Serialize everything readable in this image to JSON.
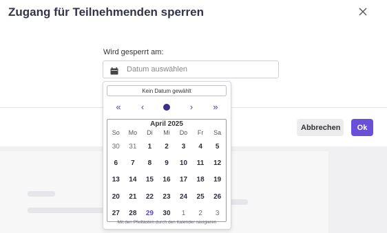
{
  "modal": {
    "title": "Zugang für Teilnehmenden sperren",
    "close_icon": "close-icon",
    "field_label": "Wird gesperrt am:",
    "date_placeholder": "Datum auswählen",
    "calendar_icon": "calendar-icon",
    "cancel_label": "Abbrechen",
    "ok_label": "Ok",
    "accent_color": "#6a4fd8"
  },
  "datepicker": {
    "no_date_label": "Kein Datum gewählt",
    "nav": {
      "prev_year_icon": "«",
      "prev_month_icon": "‹",
      "next_month_icon": "›",
      "next_year_icon": "»"
    },
    "month_label": "April 2025",
    "weekdays": [
      "So",
      "Mo",
      "Di",
      "Mi",
      "Do",
      "Fr",
      "Sa"
    ],
    "weeks": [
      [
        {
          "d": "30",
          "m": true
        },
        {
          "d": "31",
          "m": true
        },
        {
          "d": "1"
        },
        {
          "d": "2"
        },
        {
          "d": "3"
        },
        {
          "d": "4"
        },
        {
          "d": "5"
        }
      ],
      [
        {
          "d": "6"
        },
        {
          "d": "7"
        },
        {
          "d": "8"
        },
        {
          "d": "9"
        },
        {
          "d": "10"
        },
        {
          "d": "11"
        },
        {
          "d": "12"
        }
      ],
      [
        {
          "d": "13"
        },
        {
          "d": "14"
        },
        {
          "d": "15"
        },
        {
          "d": "16"
        },
        {
          "d": "17"
        },
        {
          "d": "18"
        },
        {
          "d": "19"
        }
      ],
      [
        {
          "d": "20"
        },
        {
          "d": "21"
        },
        {
          "d": "22"
        },
        {
          "d": "23"
        },
        {
          "d": "24"
        },
        {
          "d": "25"
        },
        {
          "d": "26"
        }
      ],
      [
        {
          "d": "27"
        },
        {
          "d": "28"
        },
        {
          "d": "29",
          "t": true
        },
        {
          "d": "30"
        },
        {
          "d": "1",
          "m": true
        },
        {
          "d": "2",
          "m": true
        },
        {
          "d": "3",
          "m": true
        }
      ]
    ],
    "hint": "Mit den Pfeiltasten durch den Kalender navigieren"
  }
}
